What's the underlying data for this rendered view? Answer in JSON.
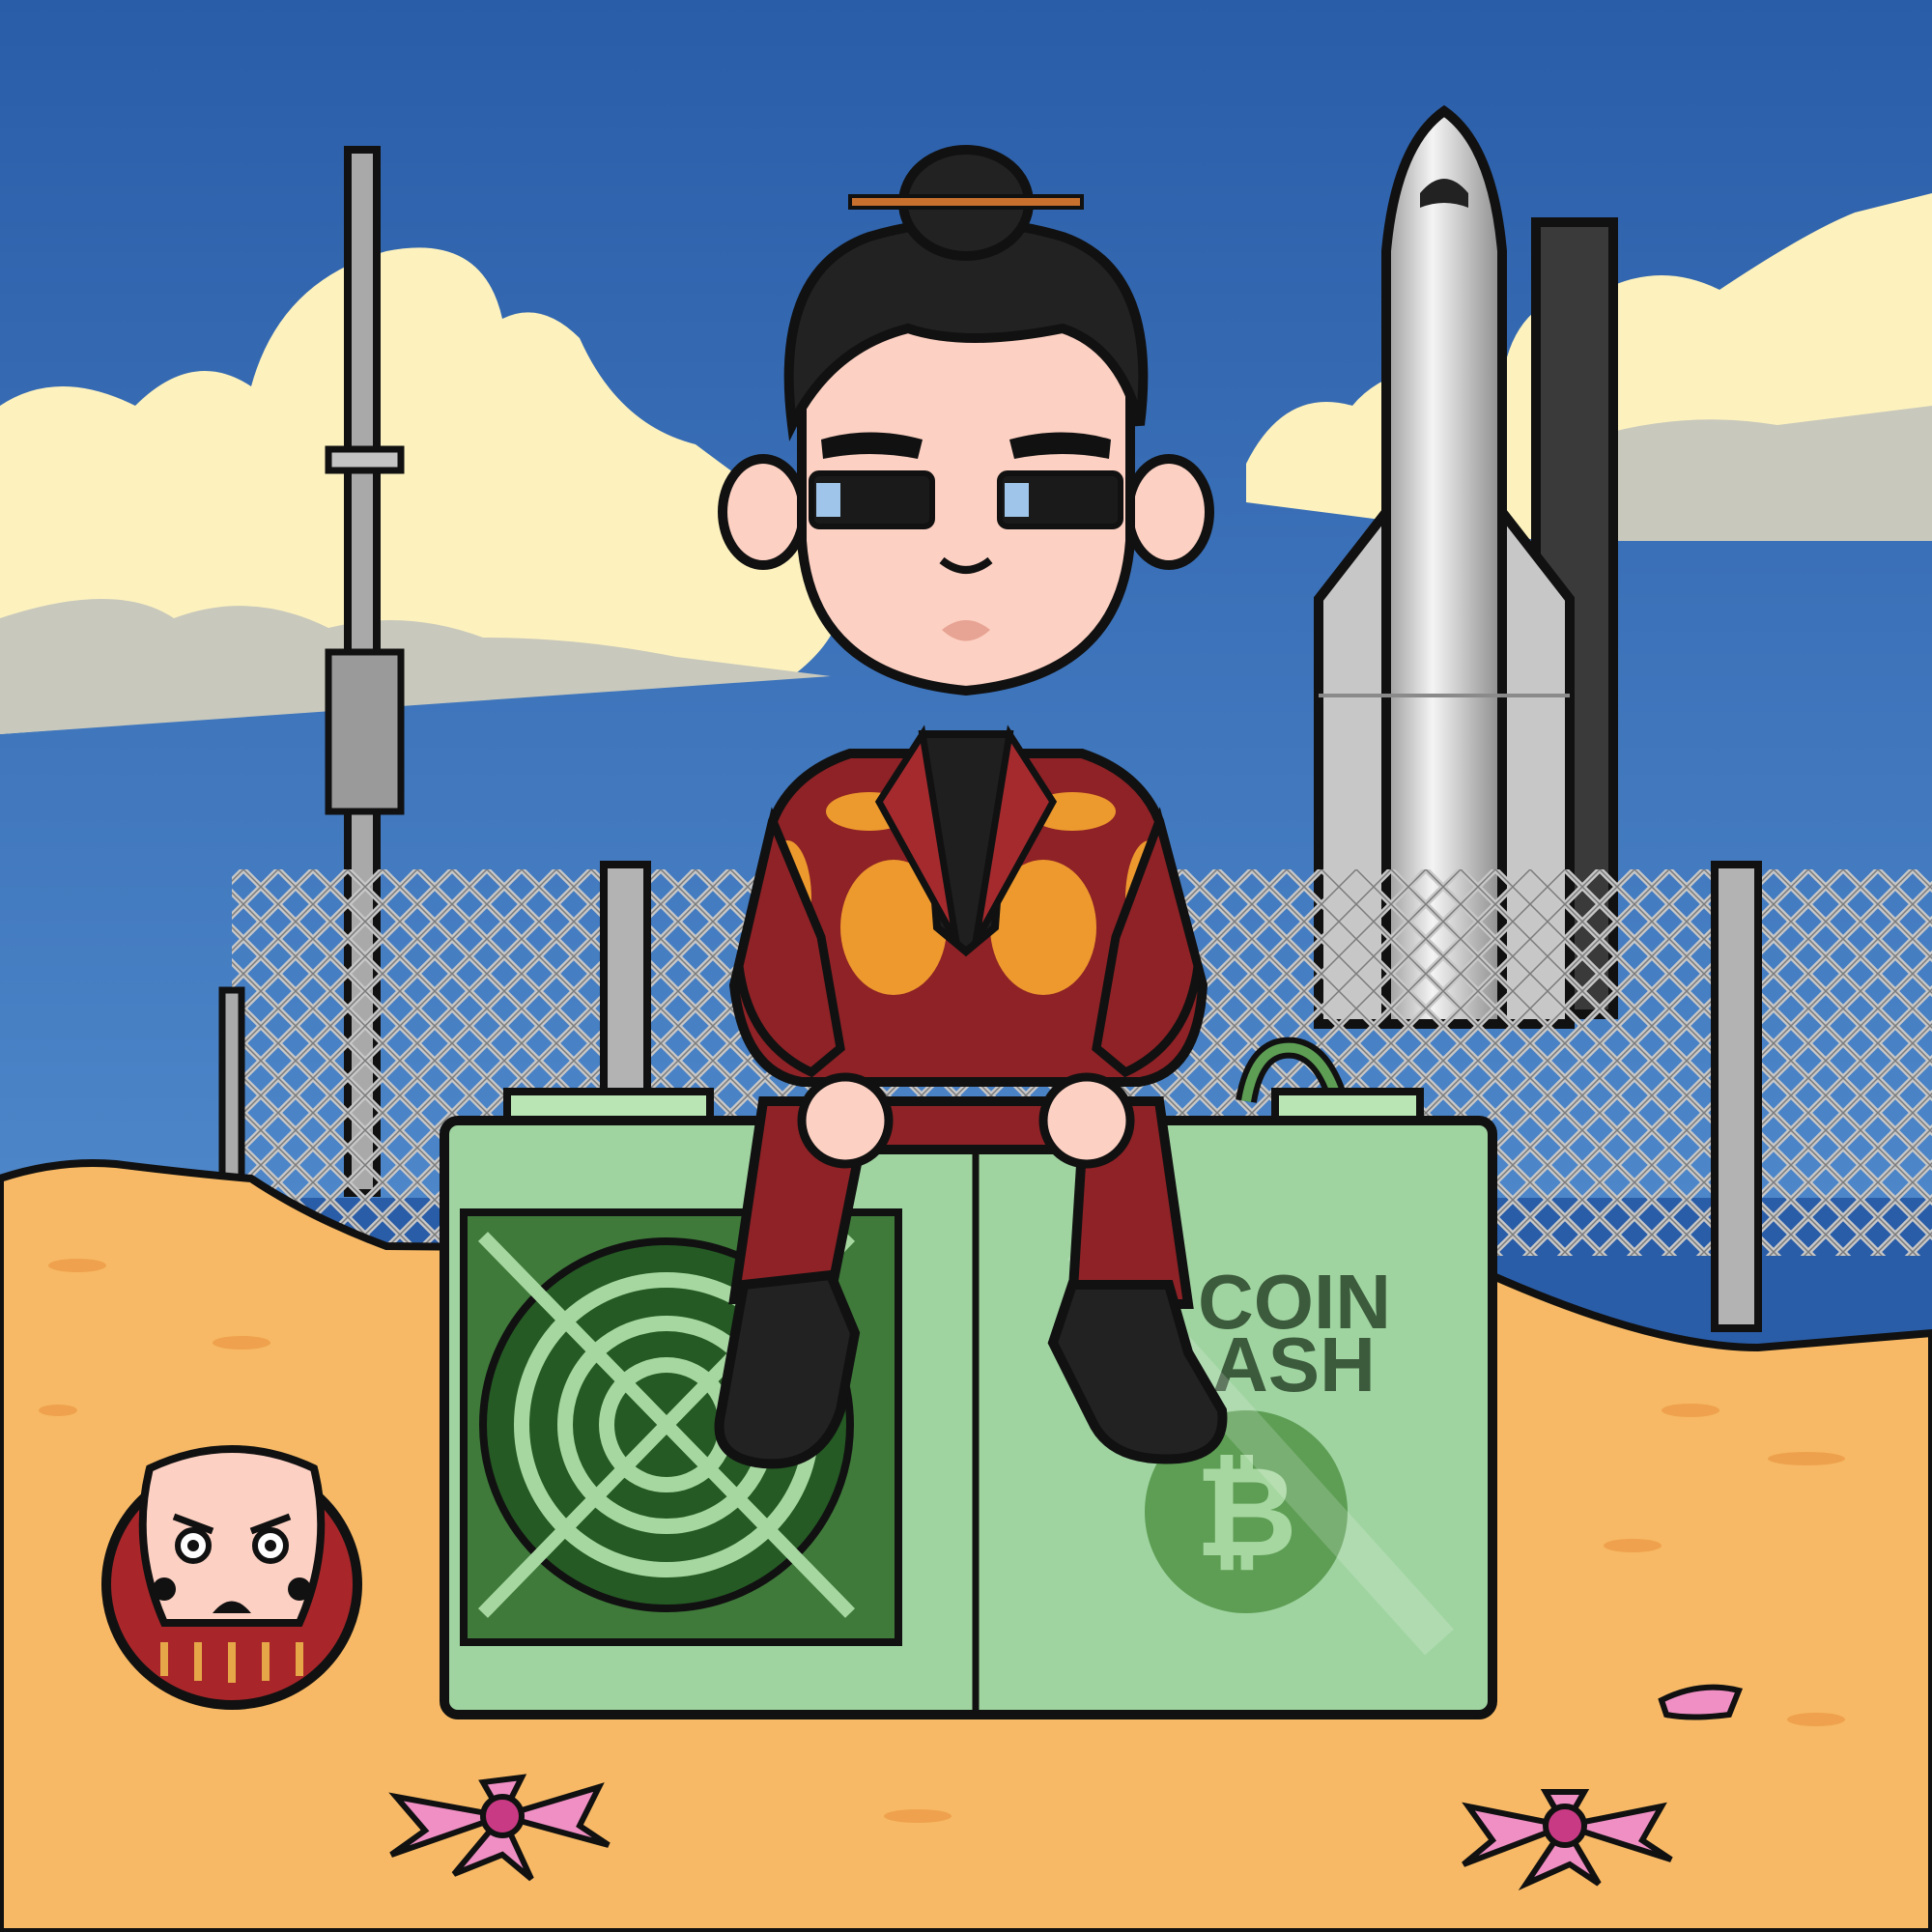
{
  "miner_label": {
    "line1": "COIN",
    "line2": "ASH"
  },
  "colors": {
    "sky": "#2a5da8",
    "cloud": "#fdf2be",
    "sand": "#f7b965",
    "miner": "#9fd4a0",
    "suit": "#8e2226",
    "pattern": "#f2a02e",
    "skin": "#fcd0c2",
    "hair": "#222222",
    "bch_circle": "#5d9e54",
    "daruma": "#a8262a",
    "petal": "#f08fc4"
  },
  "icons": [
    "rocket-icon",
    "bitcoin-cash-icon",
    "daruma-doll-icon",
    "cherry-blossom-icon",
    "fan-icon"
  ]
}
